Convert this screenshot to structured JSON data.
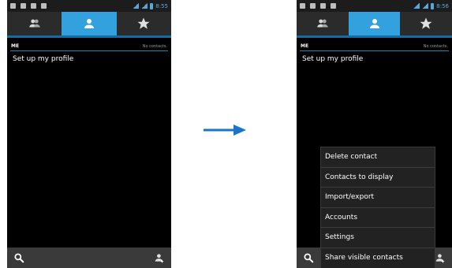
{
  "left_screen": {
    "status": {
      "time": "8:55"
    },
    "section": {
      "label": "ME",
      "empty_text": "No contacts."
    },
    "profile": {
      "label": "Set up my profile"
    }
  },
  "right_screen": {
    "status": {
      "time": "8:56"
    },
    "section": {
      "label": "ME",
      "empty_text": "No contacts."
    },
    "profile": {
      "label": "Set up my profile"
    },
    "menu": {
      "items": [
        "Delete contact",
        "Contacts to display",
        "Import/export",
        "Accounts",
        "Settings",
        "Share visible contacts"
      ]
    }
  },
  "colors": {
    "accent": "#33a1de",
    "arrow": "#1a75c8",
    "background": "#000000"
  },
  "icons": {
    "tabs": [
      "groups-icon",
      "person-icon",
      "star-icon"
    ],
    "bottom": [
      "search-icon",
      "add-contact-icon"
    ]
  }
}
